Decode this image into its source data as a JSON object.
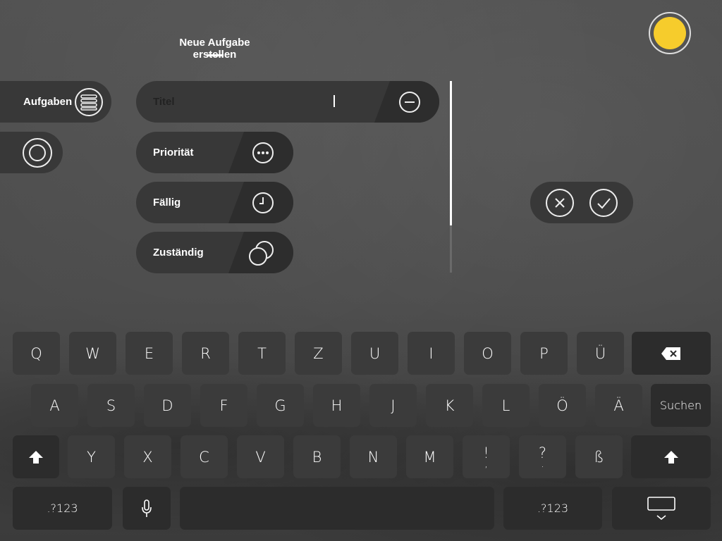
{
  "header": {
    "title": "Neue Aufgabe erstellen"
  },
  "nav": {
    "tasks_label": "Aufgaben"
  },
  "form": {
    "title_label": "Titel",
    "title_value": "",
    "priority_label": "Priorität",
    "due_label": "Fällig",
    "assignee_label": "Zuständig"
  },
  "colors": {
    "accent": "#f6cc2c",
    "pill": "#383838",
    "pill_dark": "#2d2d2d",
    "key": "#3b3b3b",
    "key_dark": "#2c2c2c"
  },
  "keyboard": {
    "row1": [
      "Q",
      "W",
      "E",
      "R",
      "T",
      "Z",
      "U",
      "I",
      "O",
      "P",
      "Ü"
    ],
    "row2": [
      "A",
      "S",
      "D",
      "F",
      "G",
      "H",
      "J",
      "K",
      "L",
      "Ö",
      "Ä"
    ],
    "search_label": "Suchen",
    "row3": [
      "Y",
      "X",
      "C",
      "V",
      "B",
      "N",
      "M",
      "!",
      "?",
      "ß"
    ],
    "row3_sub": [
      "",
      "",
      "",
      "",
      "",
      "",
      "",
      ",",
      ".",
      ""
    ],
    "numbers_label": ".?123"
  }
}
